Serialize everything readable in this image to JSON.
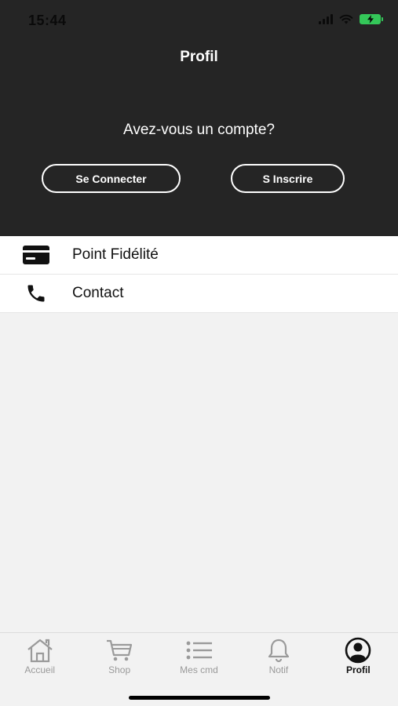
{
  "status_bar": {
    "time": "15:44",
    "icons": [
      "signal-icon",
      "wifi-icon",
      "battery-charging-icon"
    ],
    "battery_color": "#34c759"
  },
  "header": {
    "title": "Profil",
    "question": "Avez-vous un compte?",
    "login_label": "Se Connecter",
    "signup_label": "S Inscrire",
    "background": "#252525"
  },
  "menu": {
    "items": [
      {
        "label": "Point Fidélité",
        "icon": "credit-card-icon"
      },
      {
        "label": "Contact",
        "icon": "phone-icon"
      }
    ]
  },
  "tabbar": {
    "tabs": [
      {
        "label": "Accueil",
        "icon": "home-icon",
        "active": false
      },
      {
        "label": "Shop",
        "icon": "cart-icon",
        "active": false
      },
      {
        "label": "Mes cmd",
        "icon": "list-icon",
        "active": false
      },
      {
        "label": "Notif",
        "icon": "bell-icon",
        "active": false
      },
      {
        "label": "Profil",
        "icon": "user-circle-icon",
        "active": true
      }
    ],
    "inactive_color": "#9a9a9a",
    "active_color": "#111111"
  }
}
